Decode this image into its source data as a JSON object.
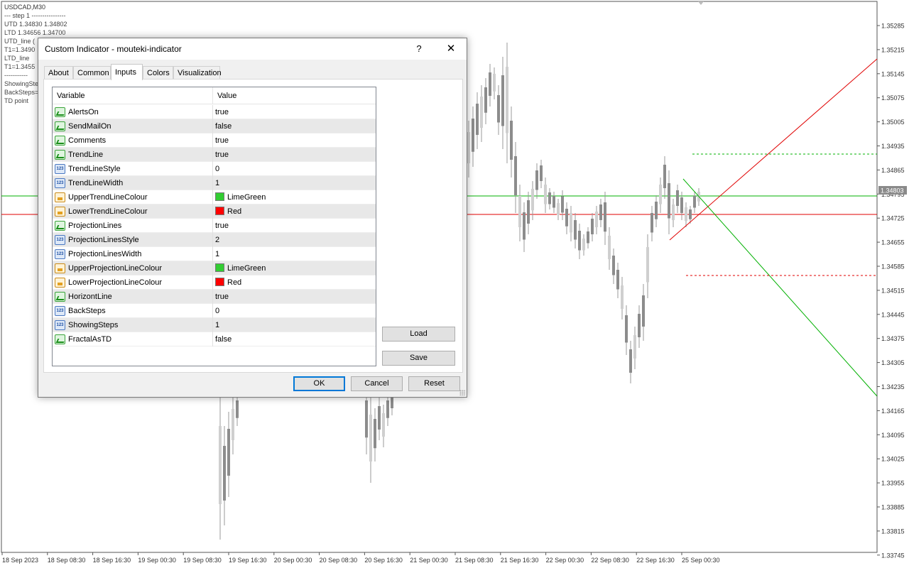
{
  "chart": {
    "symbol_label": "USDCAD,M30",
    "overlay_lines": [
      "---  step 1  ----------------",
      "UTD 1.34830  1.34802",
      "LTD  1.34656  1.34700",
      "UTD_line (",
      "T1=1.3490",
      "LTD_line",
      "T1=1.3455",
      "-----------"
    ],
    "overlay_lines2": [
      "ShowingSte",
      "BackSteps=",
      "TD point"
    ],
    "price_axis": [
      "1.35285",
      "1.35215",
      "1.35145",
      "1.35075",
      "1.35005",
      "1.34935",
      "1.34865",
      "1.34795",
      "1.34725",
      "1.34655",
      "1.34585",
      "1.34515",
      "1.34445",
      "1.34375",
      "1.34305",
      "1.34235",
      "1.34165",
      "1.34095",
      "1.34025",
      "1.33955",
      "1.33885",
      "1.33815",
      "1.33745"
    ],
    "current_price": "1.34803",
    "time_axis": [
      "18 Sep 2023",
      "18 Sep 08:30",
      "18 Sep 16:30",
      "19 Sep 00:30",
      "19 Sep 08:30",
      "19 Sep 16:30",
      "20 Sep 00:30",
      "20 Sep 08:30",
      "20 Sep 16:30",
      "21 Sep 00:30",
      "21 Sep 08:30",
      "21 Sep 16:30",
      "22 Sep 00:30",
      "22 Sep 08:30",
      "22 Sep 16:30",
      "25 Sep 00:30"
    ],
    "colors": {
      "green": "#00b000",
      "red": "#e00000",
      "candle": "#999999",
      "price_tag": "#8a8a8a"
    }
  },
  "dialog": {
    "title": "Custom Indicator - mouteki-indicator",
    "help_label": "?",
    "close_label": "✕",
    "tabs": [
      "About",
      "Common",
      "Inputs",
      "Colors",
      "Visualization"
    ],
    "active_tab": "Inputs",
    "columns": {
      "variable": "Variable",
      "value": "Value"
    },
    "params": [
      {
        "name": "AlertsOn",
        "value": "true",
        "type": "bool"
      },
      {
        "name": "SendMailOn",
        "value": "false",
        "type": "bool"
      },
      {
        "name": "Comments",
        "value": "true",
        "type": "bool"
      },
      {
        "name": "TrendLine",
        "value": "true",
        "type": "bool"
      },
      {
        "name": "TrendLineStyle",
        "value": "0",
        "type": "int"
      },
      {
        "name": "TrendLineWidth",
        "value": "1",
        "type": "int"
      },
      {
        "name": "UpperTrendLineColour",
        "value": "LimeGreen",
        "type": "color",
        "swatch": "#32cd32"
      },
      {
        "name": "LowerTrendLineColour",
        "value": "Red",
        "type": "color",
        "swatch": "#ff0000"
      },
      {
        "name": "ProjectionLines",
        "value": "true",
        "type": "bool"
      },
      {
        "name": "ProjectionLinesStyle",
        "value": "2",
        "type": "int"
      },
      {
        "name": "ProjectionLinesWidth",
        "value": "1",
        "type": "int"
      },
      {
        "name": "UpperProjectionLineColour",
        "value": "LimeGreen",
        "type": "color",
        "swatch": "#32cd32"
      },
      {
        "name": "LowerProjectionLineColour",
        "value": "Red",
        "type": "color",
        "swatch": "#ff0000"
      },
      {
        "name": "HorizontLine",
        "value": "true",
        "type": "bool"
      },
      {
        "name": "BackSteps",
        "value": "0",
        "type": "int"
      },
      {
        "name": "ShowingSteps",
        "value": "1",
        "type": "int"
      },
      {
        "name": "FractalAsTD",
        "value": "false",
        "type": "bool"
      }
    ],
    "buttons": {
      "load": "Load",
      "save": "Save",
      "ok": "OK",
      "cancel": "Cancel",
      "reset": "Reset"
    }
  }
}
